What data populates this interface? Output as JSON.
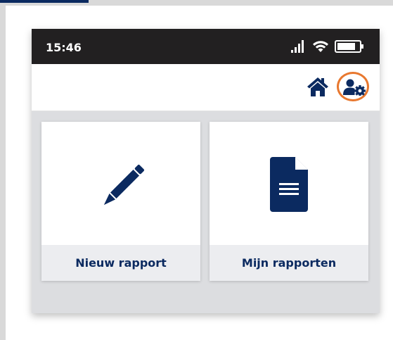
{
  "status_bar": {
    "time": "15:46",
    "icons": [
      "signal-icon",
      "wifi-icon",
      "battery-icon"
    ]
  },
  "toolbar": {
    "icons": [
      "home-icon",
      "user-settings-icon"
    ],
    "highlight_color": "#e8782f"
  },
  "tiles": [
    {
      "label": "Nieuw rapport",
      "icon": "pencil-icon"
    },
    {
      "label": "Mijn rapporten",
      "icon": "document-icon"
    }
  ],
  "colors": {
    "brand_navy": "#0b2a60",
    "status_bar_bg": "#222021",
    "tile_label_bg": "#ecedf0",
    "app_bg": "#dcdde0",
    "highlight": "#e8782f"
  }
}
